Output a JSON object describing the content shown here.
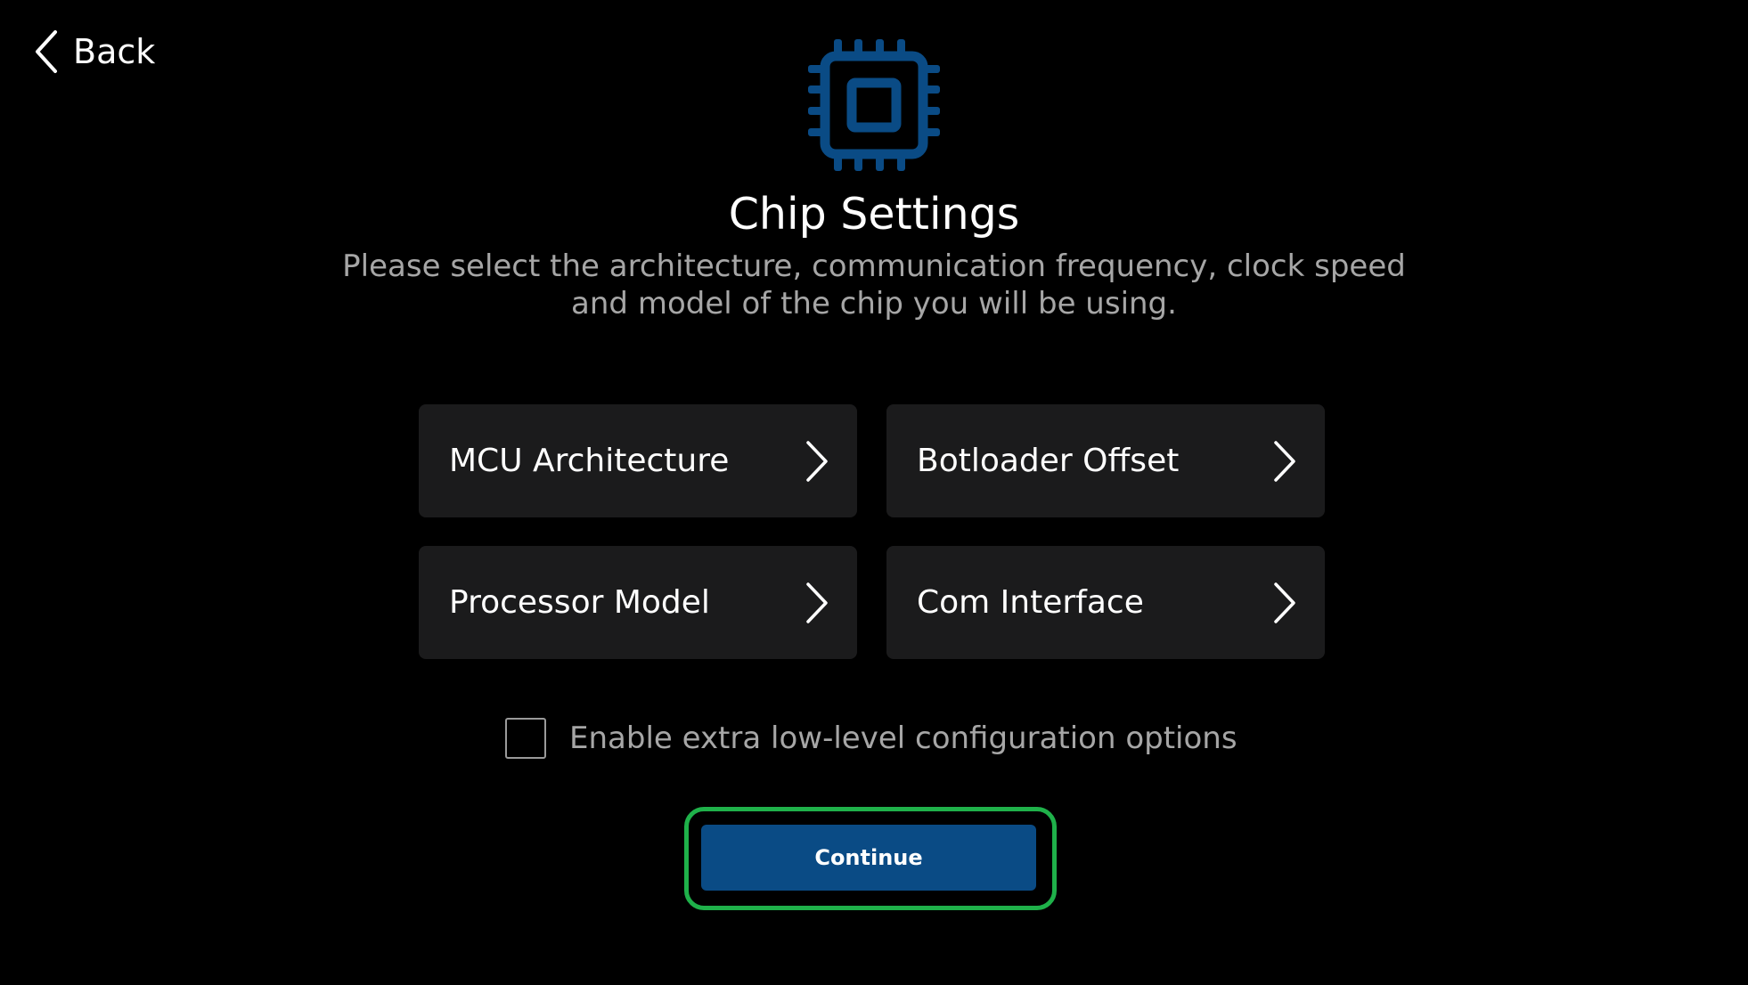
{
  "header": {
    "back_label": "Back",
    "back_icon": "chevron-left-icon"
  },
  "hero": {
    "icon": "chip-icon",
    "icon_color": "#0a4b85",
    "title": "Chip Settings",
    "subtitle_line1": "Please select the architecture, communication frequency, clock speed",
    "subtitle_line2": "and model of the chip you will be using."
  },
  "options": [
    {
      "label": "MCU Architecture",
      "icon": "chevron-right-icon"
    },
    {
      "label": "Botloader Offset",
      "icon": "chevron-right-icon"
    },
    {
      "label": "Processor Model",
      "icon": "chevron-right-icon"
    },
    {
      "label": "Com Interface",
      "icon": "chevron-right-icon"
    }
  ],
  "extra_options": {
    "label": "Enable extra low-level configuration options",
    "checked": false
  },
  "continue": {
    "label": "Continue",
    "color": "#0a4b85",
    "highlight_color": "#1fb14a"
  }
}
